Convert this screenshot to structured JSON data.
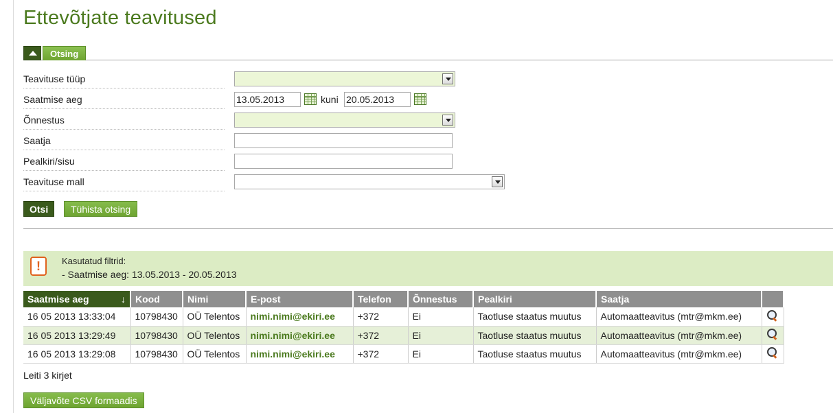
{
  "page": {
    "title": "Ettevõtjate teavitused"
  },
  "panel": {
    "tab_label": "Otsing"
  },
  "form": {
    "type_label": "Teavituse tüüp",
    "time_label": "Saatmise aeg",
    "date_from": "13.05.2013",
    "until_label": "kuni",
    "date_to": "20.05.2013",
    "success_label": "Õnnestus",
    "sender_label": "Saatja",
    "subject_label": "Pealkiri/sisu",
    "template_label": "Teavituse mall"
  },
  "actions": {
    "search": "Otsi",
    "clear": "Tühista otsing",
    "export": "Väljavõte CSV formaadis"
  },
  "filters": {
    "title": "Kasutatud filtrid:",
    "line": "- Saatmise aeg: 13.05.2013 - 20.05.2013"
  },
  "table": {
    "headers": [
      "Saatmise aeg",
      "Kood",
      "Nimi",
      "E-post",
      "Telefon",
      "Õnnestus",
      "Pealkiri",
      "Saatja",
      ""
    ],
    "sort_indicator": "↓",
    "rows": [
      [
        "16 05 2013 13:33:04",
        "10798430",
        "OÜ Telentos",
        "nimi.nimi@ekiri.ee",
        "+372",
        "Ei",
        "Taotluse staatus muutus",
        "Automaatteavitus (mtr@mkm.ee)"
      ],
      [
        "16 05 2013 13:29:49",
        "10798430",
        "OÜ Telentos",
        "nimi.nimi@ekiri.ee",
        "+372",
        "Ei",
        "Taotluse staatus muutus",
        "Automaatteavitus (mtr@mkm.ee)"
      ],
      [
        "16 05 2013 13:29:08",
        "10798430",
        "OÜ Telentos",
        "nimi.nimi@ekiri.ee",
        "+372",
        "Ei",
        "Taotluse staatus muutus",
        "Automaatteavitus (mtr@mkm.ee)"
      ]
    ]
  },
  "result_count": "Leiti 3 kirjet",
  "colors": {
    "brand_green": "#4b7a1e",
    "dark_green": "#3a5a1c",
    "light_green": "#7cb342",
    "alert_orange": "#e0621e"
  },
  "icons": {
    "toggle": "collapse-up-icon",
    "calendar": "calendar-icon",
    "warning": "warning-icon",
    "view": "magnifier-icon"
  }
}
